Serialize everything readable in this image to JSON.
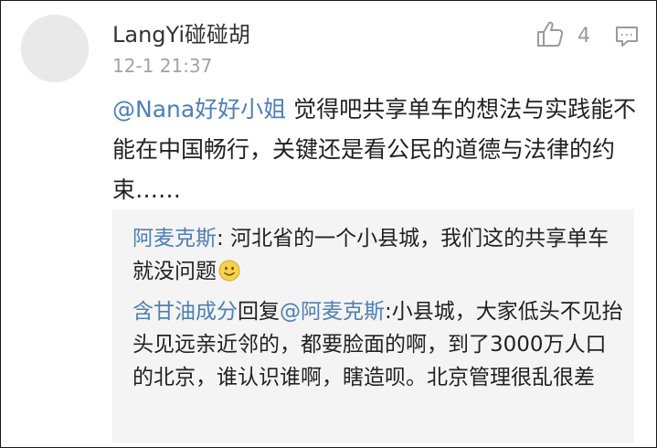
{
  "comment": {
    "username": "LangYi碰碰胡",
    "timestamp": "12-1 21:37",
    "like_count": "4",
    "mention": "@Nana好好小姐",
    "text": " 觉得吧共享单车的想法与实践能不能在中国畅行，关键还是看公民的道德与法律的约束……"
  },
  "quoted": [
    {
      "name": "阿麦克斯",
      "separator": ": ",
      "text": "河北省的一个小县城，我们这的共享单车就没问题",
      "emoji": "smile-emoji"
    },
    {
      "name": "含甘油成分",
      "reply_word": "回复",
      "reply_to": "@阿麦克斯",
      "separator": ":",
      "text": "小县城，大家低头不见抬头见远亲近邻的，都要脸面的啊，到了3000万人口的北京，谁认识谁啊，瞎造呗。北京管理很乱很差"
    }
  ],
  "icons": {
    "avatar": "default-avatar",
    "like": "thumbs-up-icon",
    "reply": "comment-bubble-icon"
  },
  "colors": {
    "link": "#4f7fb3",
    "text": "#222222",
    "muted": "#a3a3a3",
    "quote_bg": "#f4f4f4"
  }
}
